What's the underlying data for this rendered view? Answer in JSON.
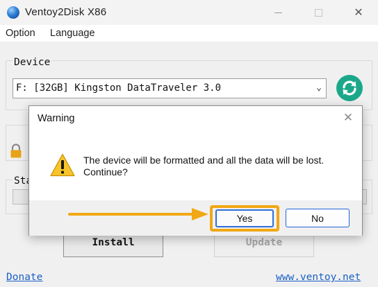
{
  "window": {
    "title": "Ventoy2Disk  X86",
    "app_icon": "ventoy-logo-icon",
    "controls": [
      "minimize-icon",
      "maximize-icon",
      "close-icon"
    ]
  },
  "menu": {
    "option_label": "Option",
    "language_label": "Language"
  },
  "device": {
    "group_label": "Device",
    "selected_device": "F: [32GB] Kingston DataTraveler 3.0",
    "refresh_icon": "refresh-icon",
    "accent": "#1ba88a"
  },
  "status": {
    "group_label": "Sta"
  },
  "buttons": {
    "install_label": "Install",
    "update_label": "Update"
  },
  "links": {
    "donate": "Donate",
    "website": "www.ventoy.net"
  },
  "dialog": {
    "title": "Warning",
    "message": "The device will be formatted and all the data will be lost. Continue?",
    "icon": "warning-icon",
    "yes_label": "Yes",
    "no_label": "No",
    "highlight_color": "#f0a814"
  }
}
